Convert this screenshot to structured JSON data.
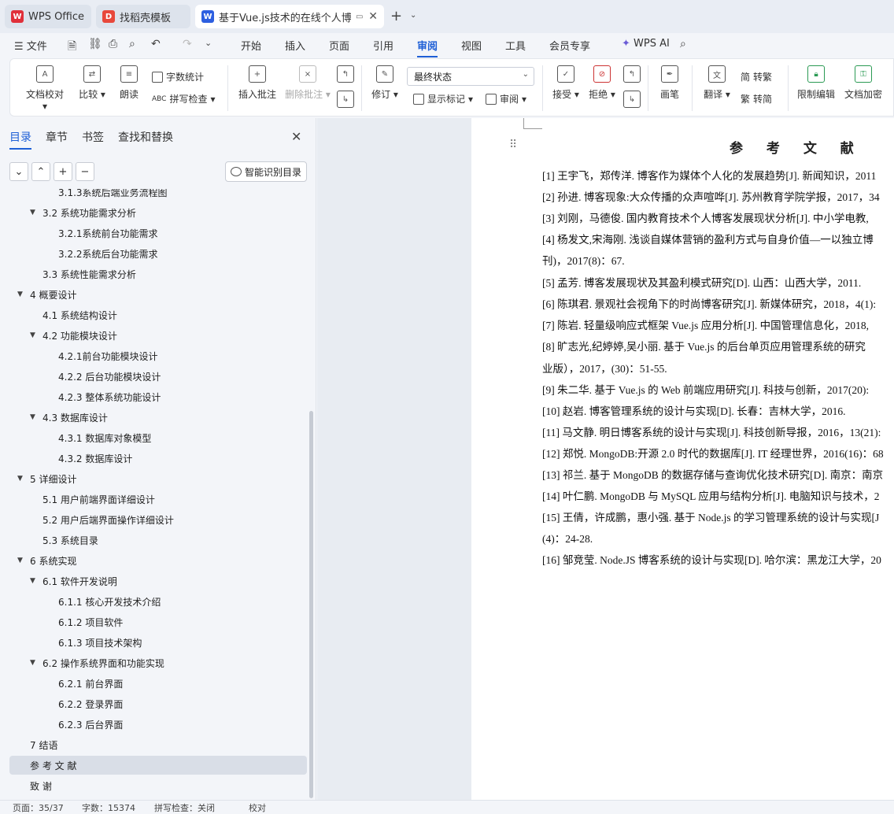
{
  "tabs": [
    {
      "label": "WPS Office",
      "icon": "wps-logo-icon"
    },
    {
      "label": "找稻壳模板",
      "icon": "docer-logo-icon"
    },
    {
      "label": "基于Vue.js技术的在线个人博客",
      "icon": "word-doc-icon",
      "active": true
    }
  ],
  "menu": {
    "file": "文件",
    "items": [
      "开始",
      "插入",
      "页面",
      "引用",
      "审阅",
      "视图",
      "工具",
      "会员专享"
    ],
    "active": "审阅",
    "ai": "WPS AI"
  },
  "ribbon": {
    "doc_check": "文档校对",
    "compare": "比较",
    "read_aloud": "朗读",
    "word_count": "字数统计",
    "spell_check": "拼写检查",
    "insert_comment": "插入批注",
    "delete_comment": "删除批注",
    "track_changes": "修订",
    "display_state": "最终状态",
    "show_markup": "显示标记",
    "review": "审阅",
    "accept": "接受",
    "reject": "拒绝",
    "ink": "画笔",
    "translate": "翻译",
    "to_traditional": "转繁",
    "to_simplified": "转简",
    "restrict_edit": "限制编辑",
    "encrypt": "文档加密"
  },
  "panel": {
    "tabs": [
      "目录",
      "章节",
      "书签",
      "查找和替换"
    ],
    "active_tab": "目录",
    "smart_btn": "智能识别目录"
  },
  "toc": [
    {
      "text": "3.1.3系统后端业务流程图",
      "indent": 3,
      "tw": ""
    },
    {
      "text": "3.2    系统功能需求分析",
      "indent": 2,
      "tw": "▼"
    },
    {
      "text": "3.2.1系统前台功能需求",
      "indent": 3,
      "tw": ""
    },
    {
      "text": "3.2.2系统后台功能需求",
      "indent": 3,
      "tw": ""
    },
    {
      "text": "3.3    系统性能需求分析",
      "indent": 2,
      "tw": ""
    },
    {
      "text": "4    概要设计",
      "indent": 1,
      "tw": "▼"
    },
    {
      "text": "4.1    系统结构设计",
      "indent": 2,
      "tw": ""
    },
    {
      "text": "4.2    功能模块设计",
      "indent": 2,
      "tw": "▼"
    },
    {
      "text": "4.2.1前台功能模块设计",
      "indent": 3,
      "tw": ""
    },
    {
      "text": "4.2.2  后台功能模块设计",
      "indent": 3,
      "tw": ""
    },
    {
      "text": "4.2.3  整体系统功能设计",
      "indent": 3,
      "tw": ""
    },
    {
      "text": "4.3    数据库设计",
      "indent": 2,
      "tw": "▼"
    },
    {
      "text": "4.3.1  数据库对象模型",
      "indent": 3,
      "tw": ""
    },
    {
      "text": "4.3.2    数据库设计",
      "indent": 3,
      "tw": ""
    },
    {
      "text": "5    详细设计",
      "indent": 1,
      "tw": "▼"
    },
    {
      "text": "5.1    用户前端界面详细设计",
      "indent": 2,
      "tw": ""
    },
    {
      "text": "5.2    用户后端界面操作详细设计",
      "indent": 2,
      "tw": ""
    },
    {
      "text": "5.3    系统目录",
      "indent": 2,
      "tw": ""
    },
    {
      "text": "6    系统实现",
      "indent": 1,
      "tw": "▼"
    },
    {
      "text": "6.1    软件开发说明",
      "indent": 2,
      "tw": "▼"
    },
    {
      "text": "6.1.1    核心开发技术介绍",
      "indent": 3,
      "tw": ""
    },
    {
      "text": "6.1.2    项目软件",
      "indent": 3,
      "tw": ""
    },
    {
      "text": "6.1.3  项目技术架构",
      "indent": 3,
      "tw": ""
    },
    {
      "text": "6.2    操作系统界面和功能实现",
      "indent": 2,
      "tw": "▼"
    },
    {
      "text": "6.2.1    前台界面",
      "indent": 3,
      "tw": ""
    },
    {
      "text": "6.2.2    登录界面",
      "indent": 3,
      "tw": ""
    },
    {
      "text": "6.2.3    后台界面",
      "indent": 3,
      "tw": ""
    },
    {
      "text": "7    结语",
      "indent": 1,
      "tw": ""
    },
    {
      "text": "参  考  文  献",
      "indent": 1,
      "tw": "",
      "selected": true
    },
    {
      "text": "致          谢",
      "indent": 1,
      "tw": ""
    }
  ],
  "document": {
    "title": "参 考 文 献",
    "references": [
      "[1]  王宇飞，郑传洋. 博客作为媒体个人化的发展趋势[J]. 新闻知识，2011",
      "[2]  孙进. 博客现象:大众传播的众声喧哗[J]. 苏州教育学院学报，2017，34",
      "[3]  刘刚，马德俊. 国内教育技术个人博客发展现状分析[J]. 中小学电教,",
      "[4]  杨发文,宋海刚. 浅谈自媒体营销的盈利方式与自身价值—一以独立博",
      "       刊)，2017(8)：67.",
      "[5]  孟芳. 博客发展现状及其盈利模式研究[D]. 山西：山西大学，2011.",
      "[6]  陈琪君. 景观社会视角下的时尚博客研究[J]. 新媒体研究，2018，4(1):",
      "[7]  陈岩. 轻量级响应式框架 Vue.js 应用分析[J]. 中国管理信息化，2018,",
      "[8]  旷志光,纪婷婷,吴小丽. 基于 Vue.js 的后台单页应用管理系统的研究",
      "       业版），2017，(30)：51-55.",
      "[9]  朱二华. 基于 Vue.js 的 Web 前端应用研究[J]. 科技与创新，2017(20):",
      "[10] 赵岩. 博客管理系统的设计与实现[D]. 长春：吉林大学，2016.",
      "[11] 马文静. 明日博客系统的设计与实现[J]. 科技创新导报，2016，13(21):",
      "[12] 郑悦. MongoDB:开源 2.0 时代的数据库[J]. IT 经理世界，2016(16)：68",
      "[13] 祁兰. 基于 MongoDB 的数据存储与查询优化技术研究[D]. 南京：南京",
      "[14] 叶仁鹏. MongoDB 与 MySQL 应用与结构分析[J]. 电脑知识与技术，2",
      "[15] 王倩，许成鹏，惠小强. 基于 Node.js 的学习管理系统的设计与实现[J",
      "       (4)：24-28.",
      "[16] 邹竞莹. Node.JS 博客系统的设计与实现[D]. 哈尔滨：黑龙江大学，20"
    ]
  },
  "status": {
    "page": "页面：35/37",
    "words": "字数：15374",
    "spell": "拼写检查：关闭",
    "proof": "校对"
  }
}
